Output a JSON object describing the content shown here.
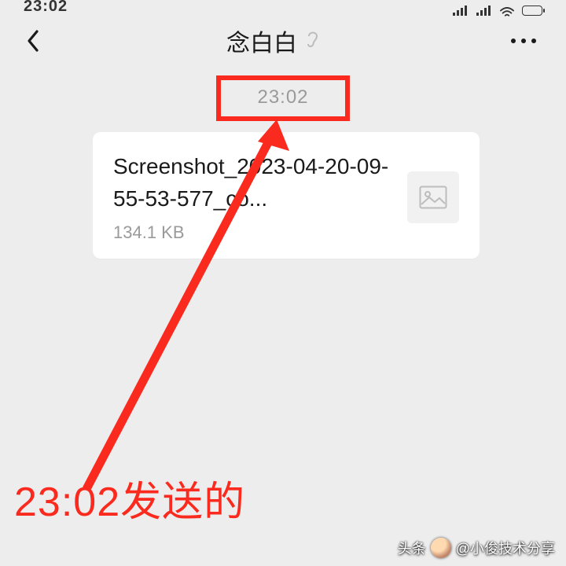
{
  "statusbar": {
    "time": "23:02"
  },
  "header": {
    "title": "念白白",
    "ear_icon": "ear-icon"
  },
  "chat": {
    "timestamp": "23:02",
    "file": {
      "name": "Screenshot_2023-04-20-09-55-53-577_co...",
      "size": "134.1 KB"
    }
  },
  "annotation": {
    "box_color": "#fa2b1e",
    "caption": "23:02发送的"
  },
  "watermark": {
    "prefix": "头条",
    "handle": "@小俊技术分享"
  }
}
